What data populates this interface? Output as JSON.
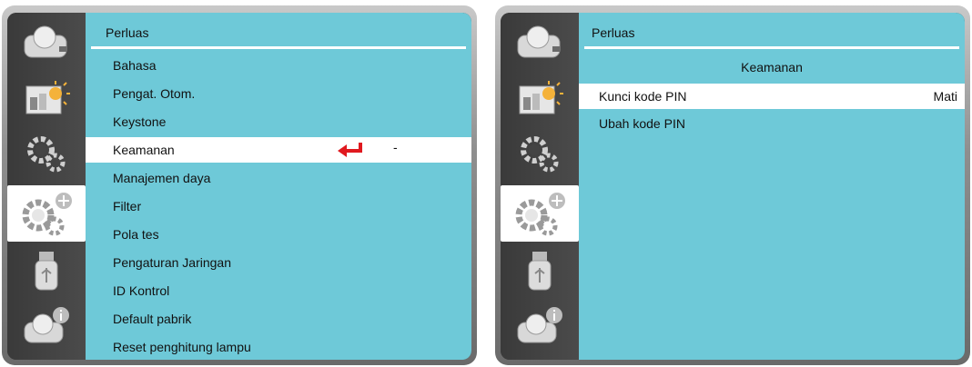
{
  "left": {
    "title": "Perluas",
    "items": [
      "Bahasa",
      "Pengat. Otom.",
      "Keystone",
      "Keamanan",
      "Manajemen daya",
      "Filter",
      "Pola tes",
      "Pengaturan Jaringan",
      "ID Kontrol",
      "Default pabrik",
      "Reset penghitung lampu"
    ],
    "selected_value": "-",
    "enter_icon_color": "#e0191f"
  },
  "right": {
    "title": "Perluas",
    "heading": "Keamanan",
    "items": [
      {
        "label": "Kunci kode PIN",
        "value": "Mati"
      },
      {
        "label": "Ubah kode PIN",
        "value": ""
      }
    ]
  },
  "sidebar_icons": [
    "camera-icon",
    "picture-brightness-icon",
    "gear-icon",
    "gear-plus-icon",
    "usb-icon",
    "info-camera-icon"
  ],
  "colors": {
    "content_bg": "#6ec9d8",
    "selected_bg": "#ffffff"
  }
}
